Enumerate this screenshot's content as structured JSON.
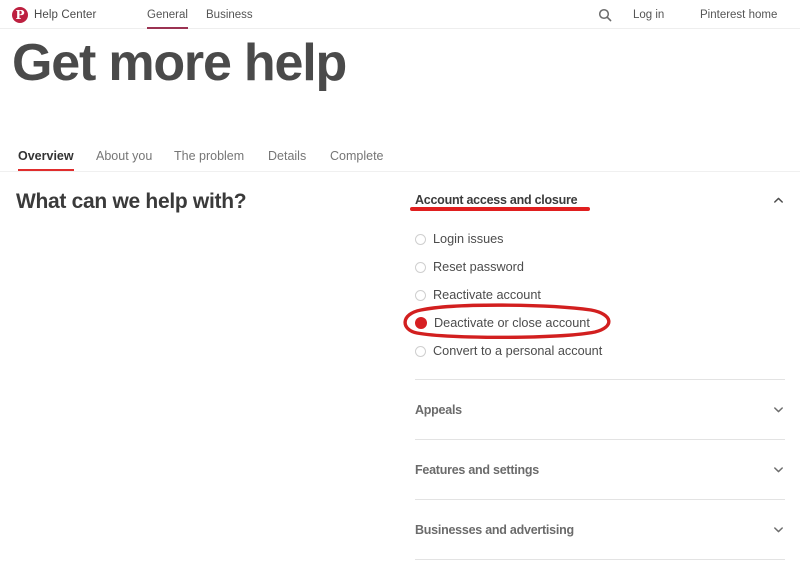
{
  "topnav": {
    "brand": {
      "logo_icon": "pinterest-logo-icon",
      "logo_glyph": "P",
      "label": "Help Center"
    },
    "tabs": [
      {
        "label": "General",
        "active": true
      },
      {
        "label": "Business",
        "active": false
      }
    ],
    "search_icon": "search-icon",
    "login_label": "Log in",
    "home_label": "Pinterest home"
  },
  "hero": {
    "title": "Get more help"
  },
  "steps": [
    {
      "label": "Overview",
      "active": true
    },
    {
      "label": "About you",
      "active": false
    },
    {
      "label": "The problem",
      "active": false
    },
    {
      "label": "Details",
      "active": false
    },
    {
      "label": "Complete",
      "active": false
    }
  ],
  "main": {
    "left_heading": "What can we help with?",
    "accordion": {
      "open_section": {
        "title": "Account access and closure",
        "chevron_icon": "chevron-up-icon",
        "options": [
          {
            "label": "Login issues",
            "selected": false
          },
          {
            "label": "Reset password",
            "selected": false
          },
          {
            "label": "Reactivate account",
            "selected": false
          },
          {
            "label": "Deactivate or close account",
            "selected": true
          },
          {
            "label": "Convert to a personal account",
            "selected": false
          }
        ]
      },
      "collapsed_sections": [
        {
          "title": "Appeals",
          "chevron_icon": "chevron-down-icon"
        },
        {
          "title": "Features and settings",
          "chevron_icon": "chevron-down-icon"
        },
        {
          "title": "Businesses and advertising",
          "chevron_icon": "chevron-down-icon"
        }
      ]
    }
  },
  "annotations": {
    "underline_color": "#e01f1f",
    "ellipse_color": "#d21f1f",
    "underline_target": "Account access and closure",
    "ellipse_target": "Deactivate or close account"
  },
  "colors": {
    "brand_red": "#bd2040",
    "accent_red": "#e02d2d",
    "tab_underline": "#9b3352",
    "radio_selected": "#d61f22",
    "heading_gray": "#4a4a4a"
  }
}
